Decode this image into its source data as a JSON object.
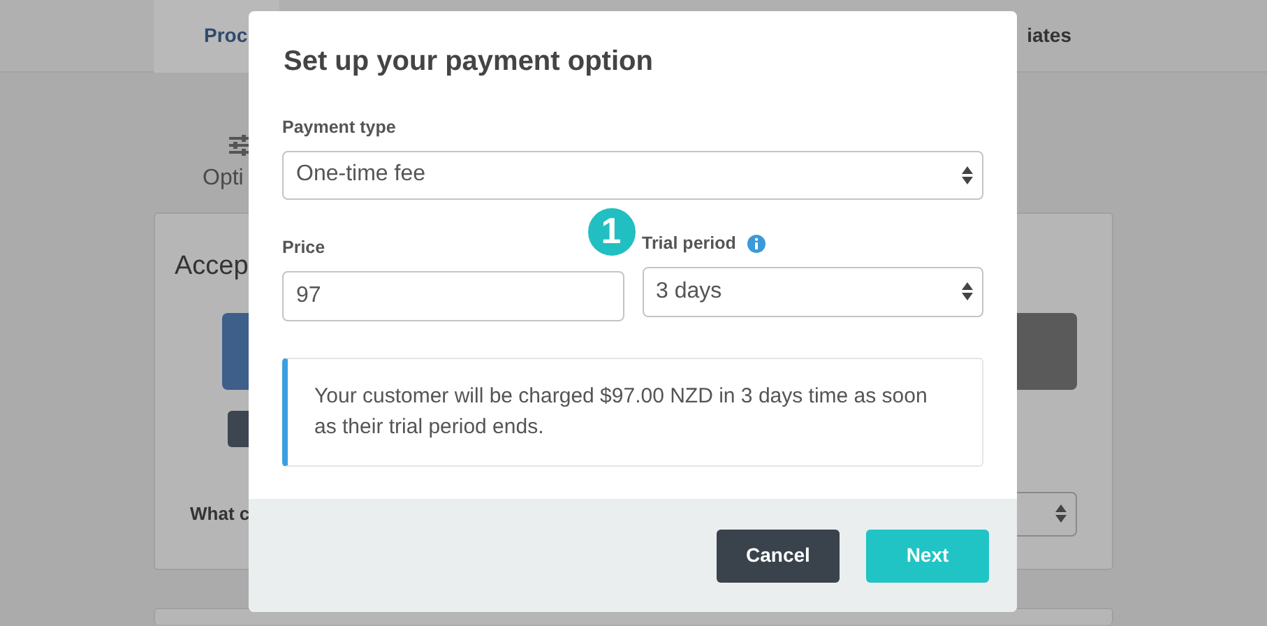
{
  "background": {
    "tabs": [
      {
        "label": "Proc",
        "selected": true
      },
      {
        "label": "iates",
        "selected": false
      }
    ],
    "option_label": "Opti",
    "card_title": "Accep",
    "field_label": "What c"
  },
  "modal": {
    "title": "Set up your payment option",
    "payment_type": {
      "label": "Payment type",
      "value": "One-time fee"
    },
    "price": {
      "label": "Price",
      "value": "97"
    },
    "trial_period": {
      "label": "Trial period",
      "value": "3 days"
    },
    "step_badge": "1",
    "notice": "Your customer will be charged $97.00 NZD in 3 days time as soon as their trial period ends.",
    "buttons": [
      {
        "label": "Cancel",
        "kind": "secondary"
      },
      {
        "label": "Next",
        "kind": "primary"
      }
    ]
  }
}
